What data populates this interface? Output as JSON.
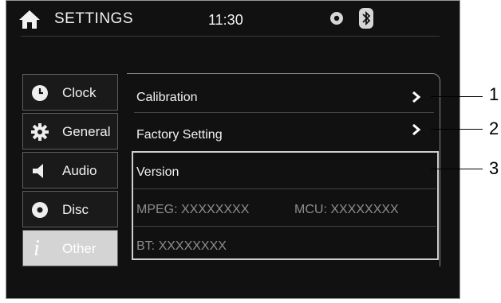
{
  "header": {
    "title": "SETTINGS",
    "time": "11:30"
  },
  "icons": {
    "home": "home-icon",
    "disc_indicator": "disc-icon",
    "bluetooth_indicator": "bluetooth-icon"
  },
  "sidebar": {
    "items": [
      {
        "label": "Clock",
        "icon": "clock-icon"
      },
      {
        "label": "General",
        "icon": "gear-icon"
      },
      {
        "label": "Audio",
        "icon": "speaker-icon"
      },
      {
        "label": "Disc",
        "icon": "disc-icon"
      },
      {
        "label": "Other",
        "icon": "info-icon",
        "selected": true
      }
    ]
  },
  "panel": {
    "calibration": "Calibration",
    "factory_setting": "Factory Setting",
    "version": {
      "title": "Version",
      "mpeg": "MPEG: XXXXXXXX",
      "mcu": "MCU: XXXXXXXX",
      "bt": "BT: XXXXXXXX"
    }
  },
  "callouts": [
    "1",
    "2",
    "3"
  ],
  "colors": {
    "background": "#111111",
    "selected": "#d4d4d4",
    "dim_text": "#8d8d8d"
  }
}
